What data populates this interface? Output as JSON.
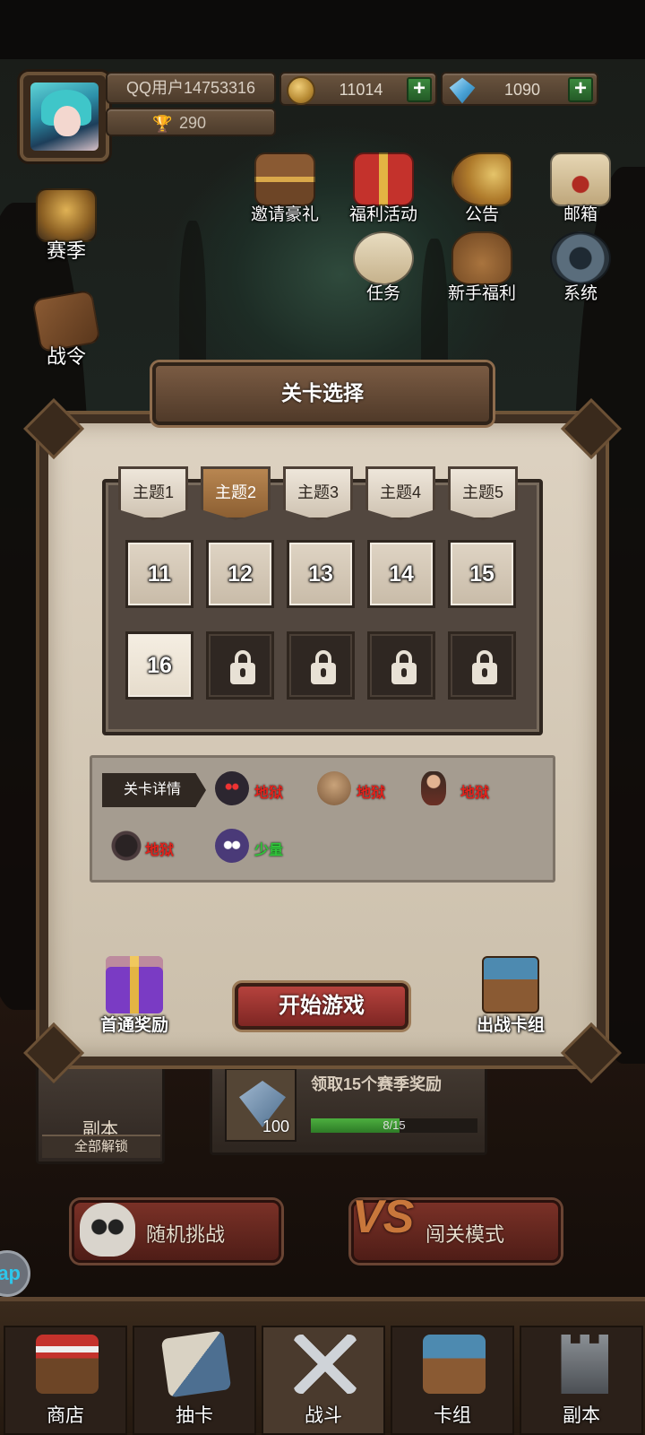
{
  "header": {
    "username": "QQ用户14753316",
    "trophies": "290",
    "coins": "11014",
    "gems": "1090",
    "plus_label": "+"
  },
  "side_menu": [
    {
      "label": "赛季",
      "icon": "trophy-cup-icon"
    },
    {
      "label": "战令",
      "icon": "battle-pass-scroll-icon"
    }
  ],
  "top_menu": {
    "row1": [
      {
        "label": "邀请豪礼",
        "icon": "treasure-chest-icon"
      },
      {
        "label": "福利活动",
        "icon": "gift-box-icon"
      },
      {
        "label": "公告",
        "icon": "megaphone-icon"
      },
      {
        "label": "邮箱",
        "icon": "mail-icon"
      }
    ],
    "row2": [
      {
        "label": "任务",
        "icon": "task-scroll-icon"
      },
      {
        "label": "新手福利",
        "icon": "beginner-bag-icon"
      },
      {
        "label": "系统",
        "icon": "settings-gear-icon"
      }
    ]
  },
  "level_select": {
    "title": "关卡选择",
    "tabs": [
      {
        "label": "主题1",
        "active": false
      },
      {
        "label": "主题2",
        "active": true
      },
      {
        "label": "主题3",
        "active": false
      },
      {
        "label": "主题4",
        "active": false
      },
      {
        "label": "主题5",
        "active": false
      }
    ],
    "levels": [
      {
        "number": "11",
        "state": "unlocked"
      },
      {
        "number": "12",
        "state": "unlocked"
      },
      {
        "number": "13",
        "state": "unlocked"
      },
      {
        "number": "14",
        "state": "unlocked"
      },
      {
        "number": "15",
        "state": "unlocked"
      },
      {
        "number": "16",
        "state": "current"
      },
      {
        "number": "",
        "state": "locked"
      },
      {
        "number": "",
        "state": "locked"
      },
      {
        "number": "",
        "state": "locked"
      },
      {
        "number": "",
        "state": "locked"
      }
    ],
    "details_label": "关卡详情",
    "monsters": [
      {
        "icon": "furry-demon-icon",
        "difficulty": "地狱"
      },
      {
        "icon": "brute-ogre-icon",
        "difficulty": "地狱"
      },
      {
        "icon": "bandit-warrior-icon",
        "difficulty": "地狱"
      },
      {
        "icon": "giant-spider-icon",
        "difficulty": "地狱"
      },
      {
        "icon": "purple-blob-icon",
        "difficulty": "少量"
      }
    ],
    "first_clear_reward": "首通奖励",
    "start_button": "开始游戏",
    "battle_deck": "出战卡组"
  },
  "background_widgets": {
    "dungeon": {
      "label": "副本",
      "sub": "全部解锁"
    },
    "season_reward": {
      "title": "领取15个赛季奖励",
      "gem_count": "100",
      "progress_text": "8/15",
      "progress": 0.533
    },
    "random_challenge": "随机挑战",
    "stage_mode": "闯关模式",
    "help_glyph": "ap"
  },
  "bottom_nav": [
    {
      "label": "商店",
      "icon": "shop-stall-icon",
      "active": false
    },
    {
      "label": "抽卡",
      "icon": "card-draw-icon",
      "active": false
    },
    {
      "label": "战斗",
      "icon": "crossed-swords-icon",
      "active": true
    },
    {
      "label": "卡组",
      "icon": "card-deck-chest-icon",
      "active": false
    },
    {
      "label": "副本",
      "icon": "dungeon-tower-icon",
      "active": false
    }
  ],
  "colors": {
    "hell": "#e3221c",
    "few": "#30c43a",
    "accent_red": "#b5423d",
    "panel_parchment": "#ddd2c1"
  }
}
